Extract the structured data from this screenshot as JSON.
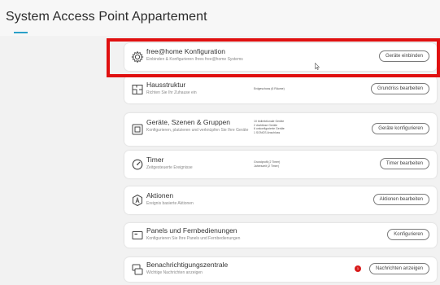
{
  "page": {
    "title": "System Access Point Appartement"
  },
  "colors": {
    "accent": "#2aa0c8",
    "highlight": "#e01010",
    "badge": "#d81b1b"
  },
  "cards": [
    {
      "icon": "gear-icon",
      "title": "free@home Konfiguration",
      "subtitle": "Einbinden & Konfigurieren Ihres free@home Systems",
      "info": "",
      "button": "Geräte einbinden"
    },
    {
      "icon": "floorplan-icon",
      "title": "Hausstruktur",
      "subtitle": "Richten Sie Ihr Zuhause ein",
      "info": "Erdgeschoss (6 Räume)",
      "button": "Grundriss bearbeiten"
    },
    {
      "icon": "devices-icon",
      "title": "Geräte, Szenen & Gruppen",
      "subtitle": "Konfigurieren, platzieren und verknüpfen Sie Ihre Geräte",
      "info_lines": [
        "10 bidirektionale Geräte",
        "2 drahtlose Geräte",
        "6 unkonfigurierte Geräte",
        "1 SONOS Anschluss"
      ],
      "button": "Geräte konfigurieren"
    },
    {
      "icon": "timer-icon",
      "title": "Timer",
      "subtitle": "Zeitgesteuerte Ereignisse",
      "info_lines": [
        "Grundprofil (2 Timer)",
        "Jahreszeit (2 Timer)"
      ],
      "button": "Timer bearbeiten"
    },
    {
      "icon": "actions-icon",
      "title": "Aktionen",
      "subtitle": "Ereignis basierte Aktionen",
      "info": "",
      "button": "Aktionen bearbeiten"
    },
    {
      "icon": "panel-icon",
      "title": "Panels und Fernbedienungen",
      "subtitle": "Konfigurieren Sie Ihre Panels und Fernbedienungen",
      "info": "",
      "button": "Konfigurieren"
    },
    {
      "icon": "notification-icon",
      "title": "Benachrichtigungszentrale",
      "subtitle": "Wichtige Nachrichten anzeigen",
      "info": "",
      "badge": "1",
      "button": "Nachrichten anzeigen"
    }
  ]
}
